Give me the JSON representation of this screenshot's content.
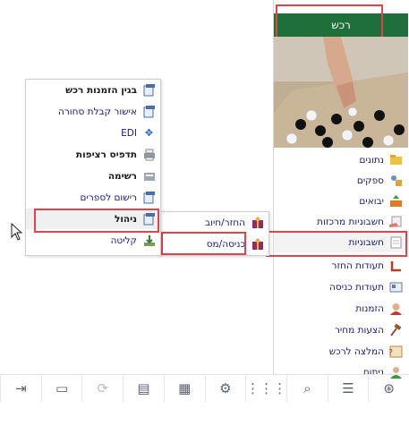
{
  "header": {
    "title": "רכש"
  },
  "menu": {
    "items": [
      {
        "label": "נתונים",
        "icon": "folder-icon"
      },
      {
        "label": "ספקים",
        "icon": "supplier-icon"
      },
      {
        "label": "יבואים",
        "icon": "import-icon"
      },
      {
        "label": "חשבוניות מרכזות",
        "icon": "hand-invoice-icon"
      },
      {
        "label": "חשבוניות",
        "icon": "invoice-icon"
      },
      {
        "label": "תעודות החזר",
        "icon": "return-icon"
      },
      {
        "label": "תעודות כניסה",
        "icon": "entry-docs-icon"
      },
      {
        "label": "הזמנות",
        "icon": "person-icon"
      },
      {
        "label": "הצעות מחיר",
        "icon": "gavel-icon"
      },
      {
        "label": "המלצה לרכש",
        "icon": "question-icon"
      },
      {
        "label": "ניתוח",
        "icon": "analyst-icon"
      }
    ]
  },
  "submenu_level1": {
    "items": [
      {
        "label": "החזר/חיוב",
        "icon": "gift-icon"
      },
      {
        "label": "כניסה/מס",
        "icon": "gift-icon"
      }
    ]
  },
  "submenu_level2": {
    "items": [
      {
        "label": "בגין הזמנות רכש",
        "icon": "document-icon",
        "bold": true
      },
      {
        "label": "אישור קבלת סחורה",
        "icon": "document-icon",
        "bold": false
      },
      {
        "label": "EDI",
        "icon": "edi-icon",
        "bold": false
      },
      {
        "label": "תדפיס רציפות",
        "icon": "printer-icon",
        "bold": true
      },
      {
        "label": "רשימה",
        "icon": "list-icon",
        "bold": true
      },
      {
        "label": "רישום לספרים",
        "icon": "document-icon",
        "bold": false
      },
      {
        "label": "ניהול",
        "icon": "document-icon",
        "bold": true
      },
      {
        "label": "קליטה",
        "icon": "download-icon",
        "bold": false
      }
    ]
  },
  "toolbar": {
    "buttons": [
      {
        "icon": "exit-icon",
        "enabled": true
      },
      {
        "icon": "monitor-icon",
        "enabled": true
      },
      {
        "icon": "refresh-icon",
        "enabled": false
      },
      {
        "icon": "message-icon",
        "enabled": true
      },
      {
        "icon": "chip-icon",
        "enabled": true
      },
      {
        "icon": "gear-icon",
        "enabled": true
      },
      {
        "icon": "apps-icon",
        "enabled": true
      },
      {
        "icon": "search-icon",
        "enabled": true
      },
      {
        "icon": "menu-icon",
        "enabled": true
      },
      {
        "icon": "nav-icon",
        "enabled": true
      }
    ]
  },
  "colors": {
    "header_bg": "#1f6f3a",
    "highlight": "#e0444d",
    "link": "#1a1a7a"
  }
}
